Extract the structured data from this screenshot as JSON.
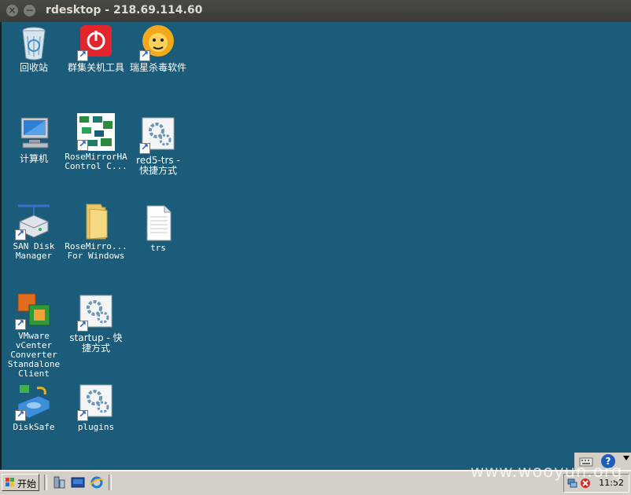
{
  "window": {
    "title": "rdesktop - 218.69.114.60",
    "close_glyph": "×",
    "minimize_glyph": "−"
  },
  "desktop": {
    "background": "#1a5c7a",
    "icons": [
      {
        "label": "回收站",
        "icon": "recycle-bin-icon"
      },
      {
        "label": "群集关机工具",
        "icon": "power-tool-icon"
      },
      {
        "label": "瑞星杀毒软件",
        "icon": "rising-antivirus-icon"
      },
      {
        "label": "计算机",
        "icon": "computer-icon"
      },
      {
        "label": "RoseMirrorHA\nControl C...",
        "icon": "rosemirror-control-icon"
      },
      {
        "label": "red5-trs -\n快捷方式",
        "icon": "gear-shortcut-icon"
      },
      {
        "label": "SAN Disk\nManager",
        "icon": "san-disk-icon"
      },
      {
        "label": "RoseMirro...\nFor Windows",
        "icon": "folder-icon"
      },
      {
        "label": "trs",
        "icon": "text-file-icon"
      },
      {
        "label": "VMware\nvCenter\nConverter\nStandalone\nClient",
        "icon": "vmware-converter-icon"
      },
      {
        "label": "startup - 快\n捷方式",
        "icon": "gear-shortcut-icon"
      },
      {
        "label": "DiskSafe",
        "icon": "disksafe-icon"
      },
      {
        "label": "plugins",
        "icon": "gear-shortcut-icon"
      }
    ]
  },
  "taskbar": {
    "start_label": "开始",
    "clock": "11:52",
    "help_glyph": "?"
  },
  "watermark": "www.wooyun.org"
}
